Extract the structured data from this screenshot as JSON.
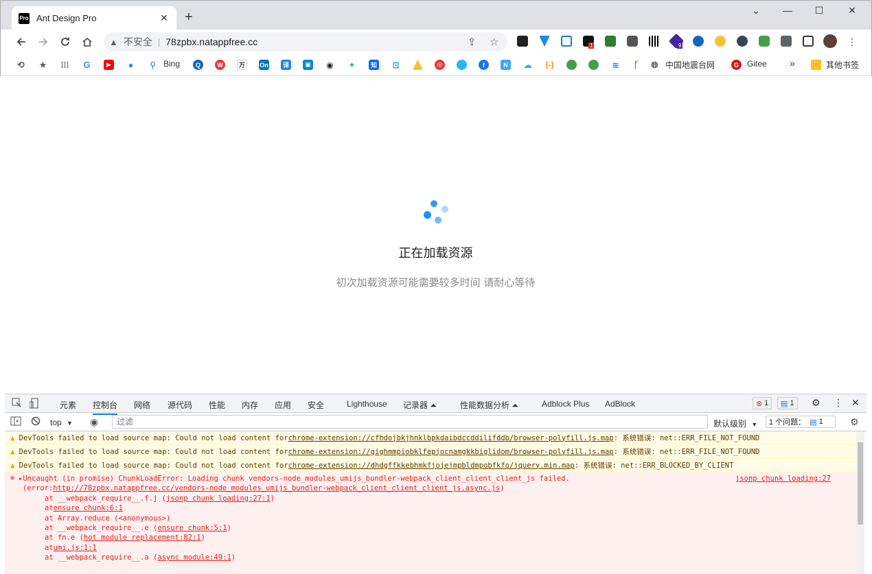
{
  "tab": {
    "favicon": "Pro",
    "title": "Ant Design Pro",
    "close": "✕",
    "new_tab": "+"
  },
  "window": {
    "minimize": "⌄",
    "restore": "—",
    "maximize": "☐",
    "close": "✕"
  },
  "nav": {
    "security_label": "不安全",
    "url": "78zpbx.natappfree.cc",
    "ext_badge_1": "1",
    "ext_badge_2": "9"
  },
  "bookmarks": {
    "bing": "Bing",
    "earthquake": "中国地震台网",
    "gitee": "Gitee",
    "more": "»",
    "other": "其他书签"
  },
  "page": {
    "loading_title": "正在加载资源",
    "loading_sub": "初次加载资源可能需要较多时间 请耐心等待"
  },
  "devtools": {
    "tabs": [
      "元素",
      "控制台",
      "网络",
      "源代码",
      "性能",
      "内存",
      "应用",
      "安全",
      "Lighthouse",
      "记录器 ⏶",
      "性能数据分析 ⏶",
      "Adblock Plus",
      "AdBlock"
    ],
    "error_count": "1",
    "message_count": "1",
    "context": "top",
    "filter_placeholder": "过滤",
    "level": "默认级别",
    "issues_label": "1 个问题：",
    "issues_count": "1",
    "warnings": [
      {
        "prefix": "DevTools failed to load source map: Could not load content for ",
        "link": "chrome-extension://cfhdojbkjhnklbpkdaibdccddilifddb/browser-polyfill.js.map",
        "suffix": ": 系统错误: net::ERR_FILE_NOT_FOUND"
      },
      {
        "prefix": "DevTools failed to load source map: Could not load content for ",
        "link": "chrome-extension://gighmmpiobklfepjocnamgkkbiglidom/browser-polyfill.js.map",
        "suffix": ": 系统错误: net::ERR_FILE_NOT_FOUND"
      },
      {
        "prefix": "DevTools failed to load source map: Could not load content for ",
        "link": "chrome-extension://dhdgffkkebhmkfjojejmpbldmpobfkfo/jquery.min.map",
        "suffix": ": 系统错误: net::ERR_BLOCKED_BY_CLIENT"
      }
    ],
    "error": {
      "main": "▸Uncaught (in promise) ChunkLoadError: Loading chunk vendors-node_modules_umijs_bundler-webpack_client_client_client_js failed.",
      "source": "jsonp chunk loading:27",
      "detail_prefix": "(error: ",
      "detail_link": "http://78zpbx.natappfree.cc/vendors-node_modules_umijs_bundler-webpack_client_client_client_js.async.js",
      "detail_suffix": ")",
      "trace": [
        {
          "text": "at __webpack_require__.f.j (",
          "link": "jsonp chunk loading:27:1",
          "end": ")"
        },
        {
          "text": "at ",
          "link": "ensure chunk:6:1",
          "end": ""
        },
        {
          "text": "at Array.reduce (<anonymous>)",
          "link": "",
          "end": ""
        },
        {
          "text": "at __webpack_require__.e (",
          "link": "ensure chunk:5:1",
          "end": ")"
        },
        {
          "text": "at fn.e (",
          "link": "hot module replacement:82:1",
          "end": ")"
        },
        {
          "text": "at ",
          "link": "umi.js:1:1",
          "end": ""
        },
        {
          "text": "at __webpack_require__.a (",
          "link": "async module:49:1",
          "end": ")"
        }
      ]
    }
  }
}
